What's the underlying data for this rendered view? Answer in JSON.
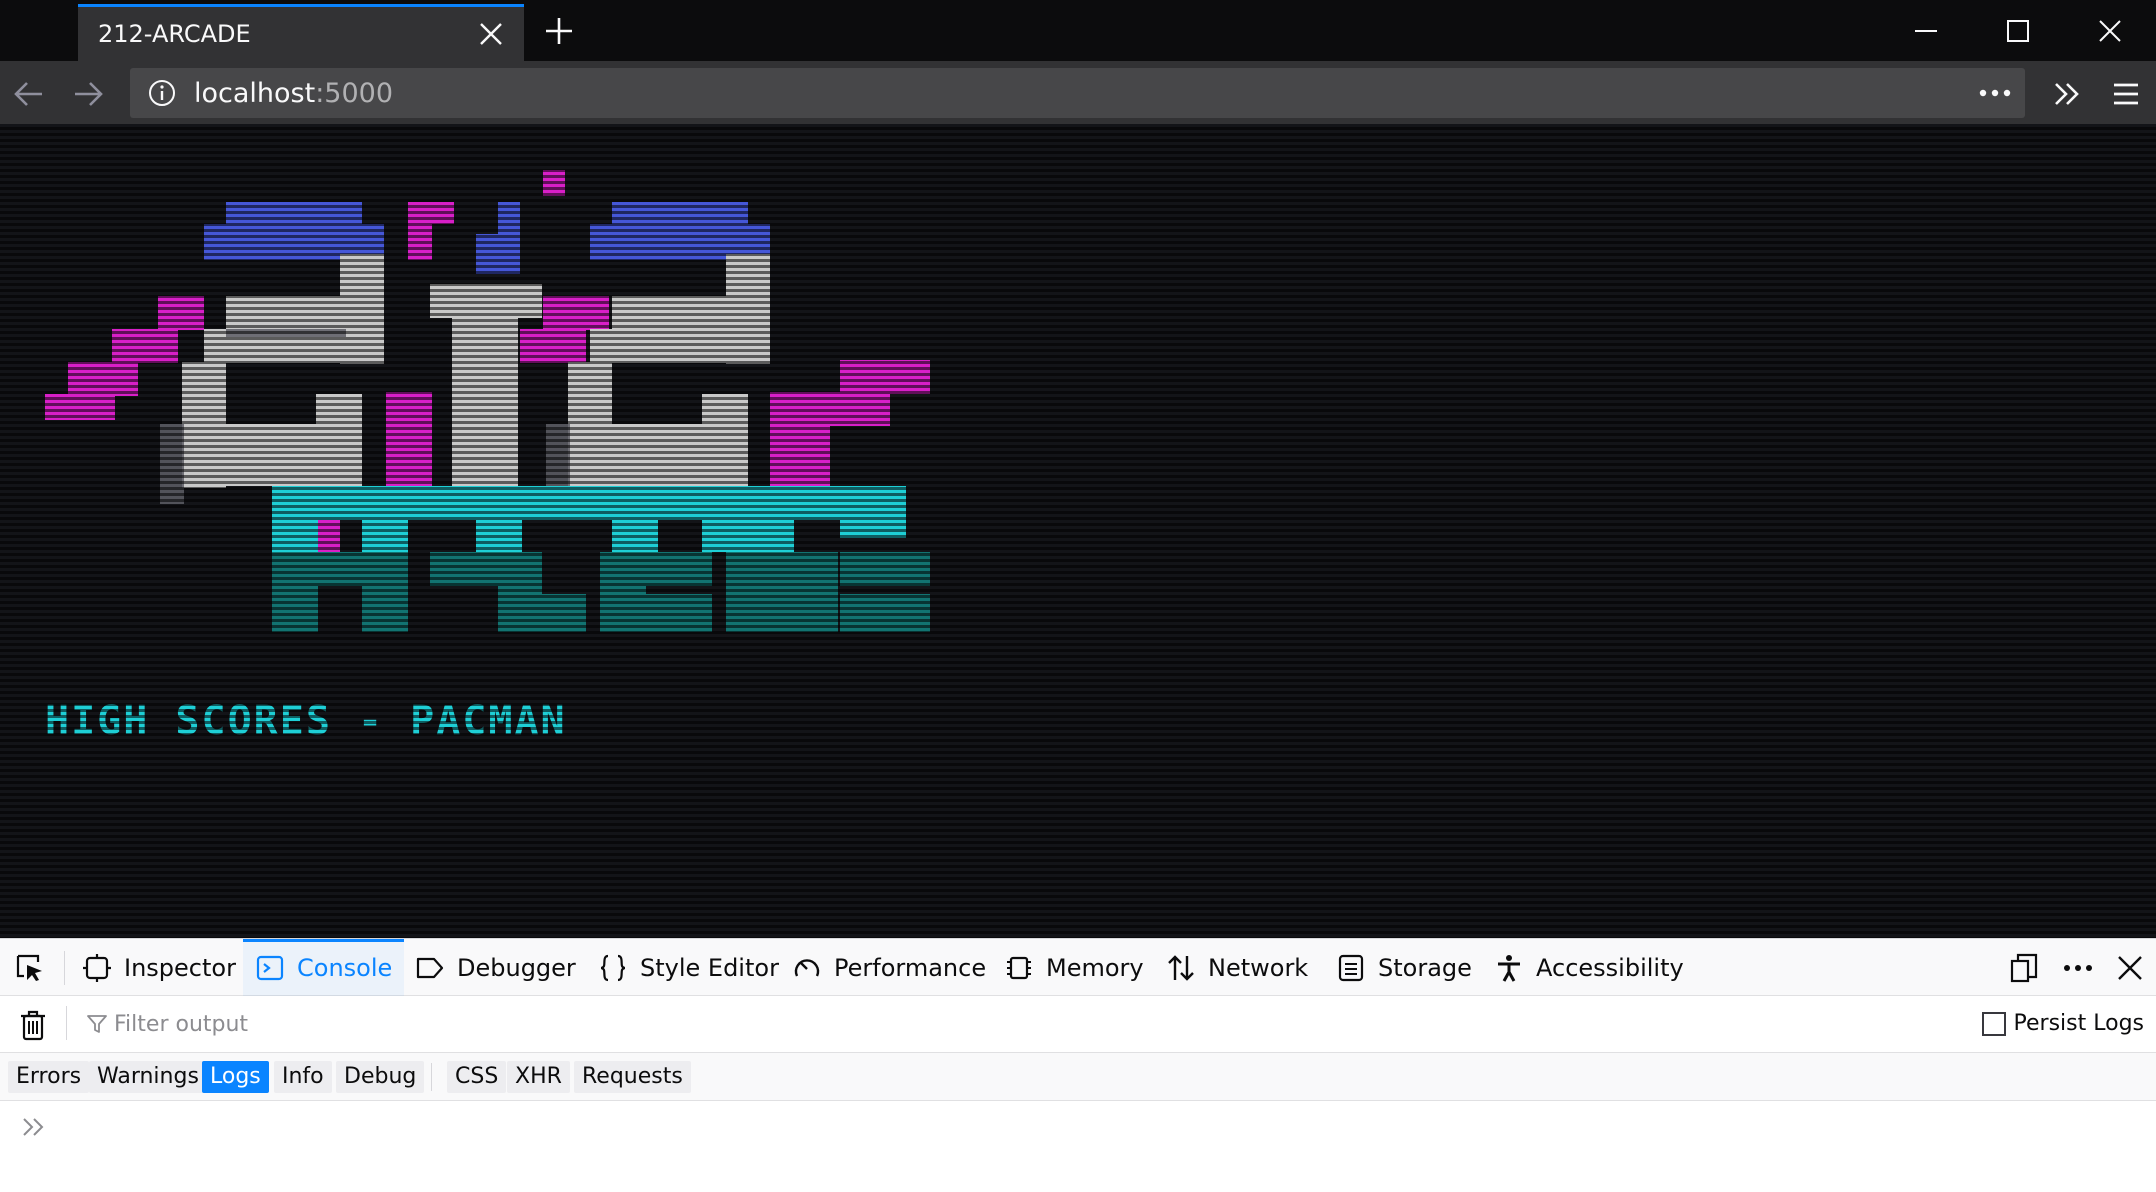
{
  "browser": {
    "tab_title": "212-ARCADE",
    "url_host": "localhost",
    "url_port": ":5000"
  },
  "page": {
    "heading": "HIGH SCORES - PACMAN",
    "logo": {
      "top_text": "212",
      "bottom_text": "ARCADE",
      "colors": {
        "blue": "#4557d8",
        "gray": "#c9c9c9",
        "magenta": "#d81fc8",
        "cyan": "#1ecfd6",
        "teal": "#127371"
      }
    },
    "colors": {
      "background": "#131418",
      "heading": "#1ecfd6"
    }
  },
  "devtools": {
    "tabs": [
      {
        "label": "Inspector",
        "icon": "inspector-icon"
      },
      {
        "label": "Console",
        "icon": "console-icon",
        "selected": true
      },
      {
        "label": "Debugger",
        "icon": "debugger-icon"
      },
      {
        "label": "Style Editor",
        "icon": "style-editor-icon"
      },
      {
        "label": "Performance",
        "icon": "performance-icon"
      },
      {
        "label": "Memory",
        "icon": "memory-icon"
      },
      {
        "label": "Network",
        "icon": "network-icon"
      },
      {
        "label": "Storage",
        "icon": "storage-icon"
      },
      {
        "label": "Accessibility",
        "icon": "accessibility-icon"
      }
    ],
    "filter_placeholder": "Filter output",
    "persist_logs_label": "Persist Logs",
    "levels": [
      {
        "label": "Errors",
        "on": false
      },
      {
        "label": "Warnings",
        "on": false
      },
      {
        "label": "Logs",
        "on": true
      },
      {
        "label": "Info",
        "on": false
      },
      {
        "label": "Debug",
        "on": false
      }
    ],
    "extra_filters": [
      "CSS",
      "XHR",
      "Requests"
    ],
    "accent": "#0a84ff"
  }
}
